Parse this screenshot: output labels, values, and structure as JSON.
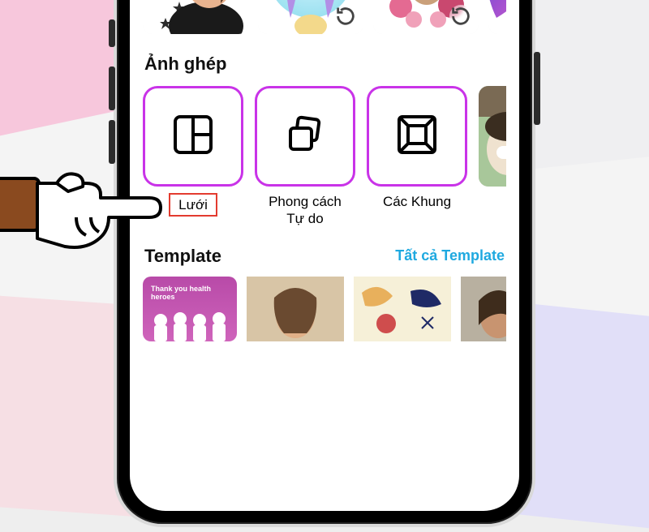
{
  "sections": {
    "collage": {
      "title": "Ảnh ghép",
      "tiles": [
        {
          "key": "grid",
          "label": "Lưới",
          "icon": "grid-icon",
          "highlighted": true
        },
        {
          "key": "free",
          "label": "Phong cách\nTự do",
          "icon": "stack-icon",
          "highlighted": false
        },
        {
          "key": "frame",
          "label": "Các Khung",
          "icon": "frame-icon",
          "highlighted": false
        }
      ]
    },
    "templates": {
      "title": "Template",
      "all_link": "Tất cả Template"
    }
  },
  "colors": {
    "accent_border": "#c933e8",
    "link": "#1fa9e0",
    "highlight_box": "#e33b2f"
  },
  "artwork_row": {
    "items": [
      {
        "name": "art-thumb-stars",
        "badge": false
      },
      {
        "name": "art-thumb-purple",
        "badge": true
      },
      {
        "name": "art-thumb-floral",
        "badge": true
      },
      {
        "name": "art-thumb-galaxy",
        "badge": false
      }
    ]
  },
  "template_thumbs": [
    {
      "caption": "Thank you health heroes"
    }
  ]
}
